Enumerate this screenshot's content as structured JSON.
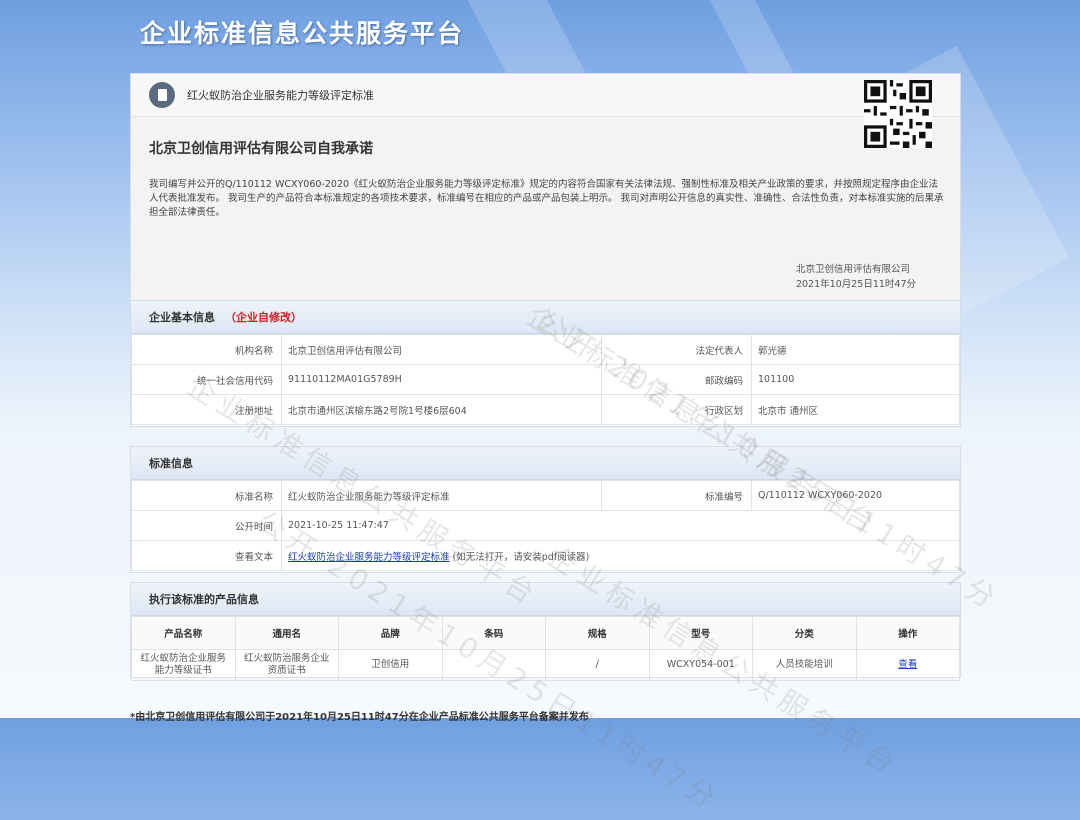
{
  "banner": {
    "title": "企业标准信息公共服务平台"
  },
  "header": {
    "standard_title": "红火蚁防治企业服务能力等级评定标准",
    "commitment_title": "北京卫创信用评估有限公司自我承诺",
    "commitment_text": "我司编写并公开的Q/110112 WCXY060-2020《红火蚁防治企业服务能力等级评定标准》规定的内容符合国家有关法律法规、强制性标准及相关产业政策的要求，并按照规定程序由企业法人代表批准发布。 我司生产的产品符合本标准规定的各项技术要求，标准编号在相应的产品或产品包装上明示。 我司对声明公开信息的真实性、准确性、合法性负责，对本标准实施的后果承担全部法律责任。",
    "sign_company": "北京卫创信用评估有限公司",
    "sign_date": "2021年10月25日11时47分"
  },
  "basic": {
    "heading": "企业基本信息",
    "self_edit": "（企业自修改）",
    "rows": [
      {
        "l1": "机构名称",
        "v1": "北京卫创信用评估有限公司",
        "l2": "法定代表人",
        "v2": "郭光德"
      },
      {
        "l1": "统一社会信用代码",
        "v1": "91110112MA01G5789H",
        "l2": "邮政编码",
        "v2": "101100"
      },
      {
        "l1": "注册地址",
        "v1": "北京市通州区滨榆东路2号院1号楼6层604",
        "l2": "行政区划",
        "v2": "北京市 通州区"
      }
    ]
  },
  "standard": {
    "heading": "标准信息",
    "name_label": "标准名称",
    "name_value": "红火蚁防治企业服务能力等级评定标准",
    "code_label": "标准编号",
    "code_value": "Q/110112 WCXY060-2020",
    "time_label": "公开时间",
    "time_value": "2021-10-25 11:47:47",
    "view_label": "查看文本",
    "view_link": "红火蚁防治企业服务能力等级评定标准",
    "view_hint": "(如无法打开，请安装pdf阅读器)"
  },
  "products": {
    "heading": "执行该标准的产品信息",
    "columns": [
      "产品名称",
      "通用名",
      "品牌",
      "条码",
      "规格",
      "型号",
      "分类",
      "操作"
    ],
    "rows": [
      {
        "name": "红火蚁防治企业服务能力等级证书",
        "common": "红火蚁防治服务企业资质证书",
        "brand": "卫创信用",
        "barcode": "",
        "spec": "/",
        "model": "WCXY054-001",
        "category": "人员技能培训",
        "action": "查看"
      }
    ]
  },
  "footer": {
    "text": "*由北京卫创信用评估有限公司于2021年10月25日11时47分在企业产品标准公共服务平台备案并发布"
  },
  "watermarks": [
    "企业标准信息公共服务平台",
    "公开 2021年10月25日11时47分"
  ]
}
